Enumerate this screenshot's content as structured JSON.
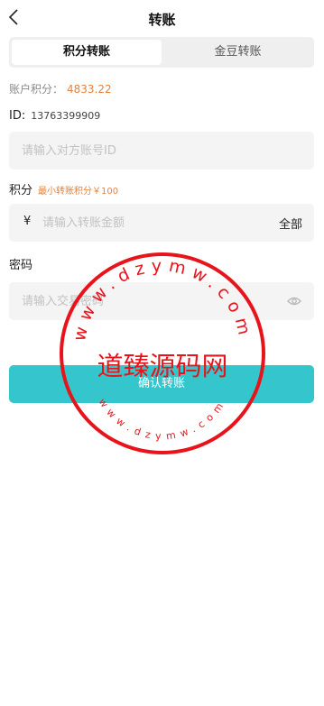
{
  "header": {
    "title": "转账"
  },
  "tabs": [
    {
      "label": "积分转账",
      "active": true
    },
    {
      "label": "金豆转账",
      "active": false
    }
  ],
  "balance": {
    "label": "账户积分：",
    "value": "4833.22"
  },
  "account_id": {
    "label": "ID:",
    "value": "13763399909"
  },
  "recipient": {
    "placeholder": "请输入对方账号ID"
  },
  "points": {
    "label": "积分",
    "hint": "最小转账积分￥100",
    "currency": "¥",
    "placeholder": "请输入转账金额",
    "all_label": "全部"
  },
  "password": {
    "label": "密码",
    "placeholder": "请输入交易密码"
  },
  "submit": {
    "label": "确认转账"
  },
  "watermark": {
    "center_text": "道臻源码网",
    "top_arc": "www.dzymw.com",
    "bottom_arc": "www.dzymw.com"
  },
  "colors": {
    "accent": "#34c6cc",
    "highlight": "#e7823a",
    "watermark": "#e8141c"
  }
}
